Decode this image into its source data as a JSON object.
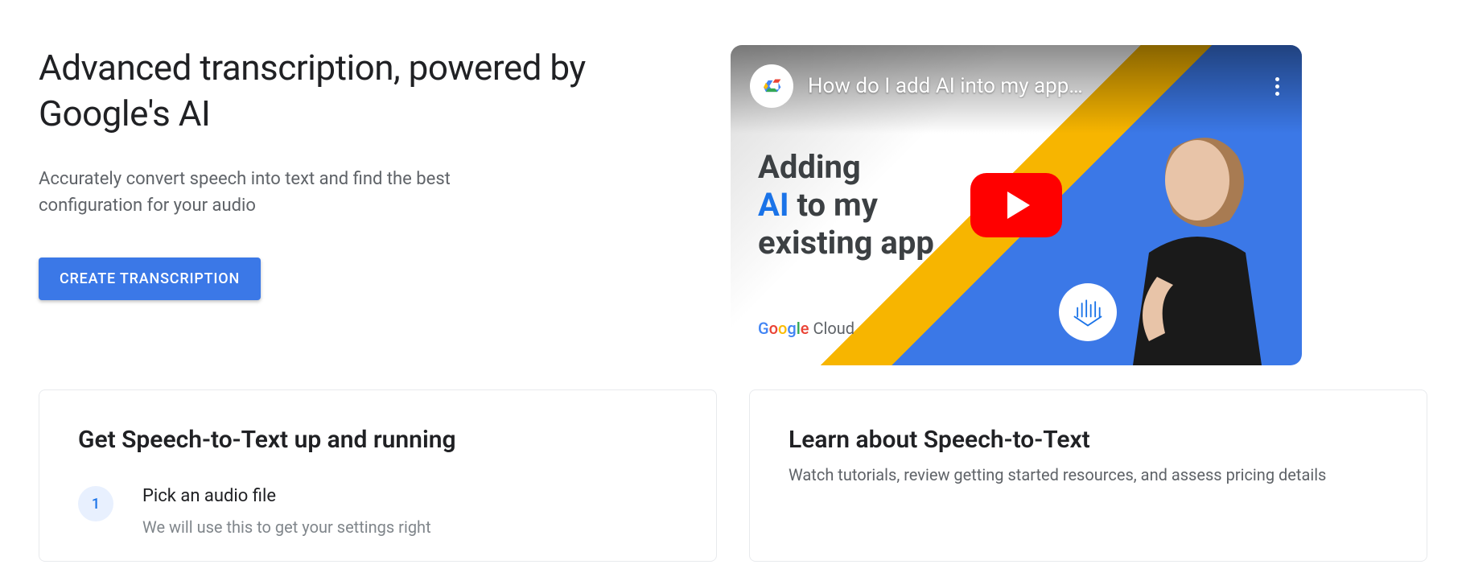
{
  "hero": {
    "title": "Advanced transcription, powered by Google's AI",
    "subtitle": "Accurately convert speech into text and find the best configuration for your audio",
    "cta_label": "CREATE TRANSCRIPTION"
  },
  "video": {
    "title": "How do I add AI into my app…",
    "overlay_line1": "Adding",
    "overlay_ai": "AI",
    "overlay_line2_rest": " to my",
    "overlay_line3": "existing app",
    "brand_google": "Google",
    "brand_cloud": " Cloud"
  },
  "cards": {
    "left": {
      "title": "Get Speech-to-Text up and running",
      "step1_num": "1",
      "step1_title": "Pick an audio file",
      "step1_desc": "We will use this to get your settings right"
    },
    "right": {
      "title": "Learn about Speech-to-Text",
      "subtitle": "Watch tutorials, review getting started resources, and assess pricing details"
    }
  }
}
